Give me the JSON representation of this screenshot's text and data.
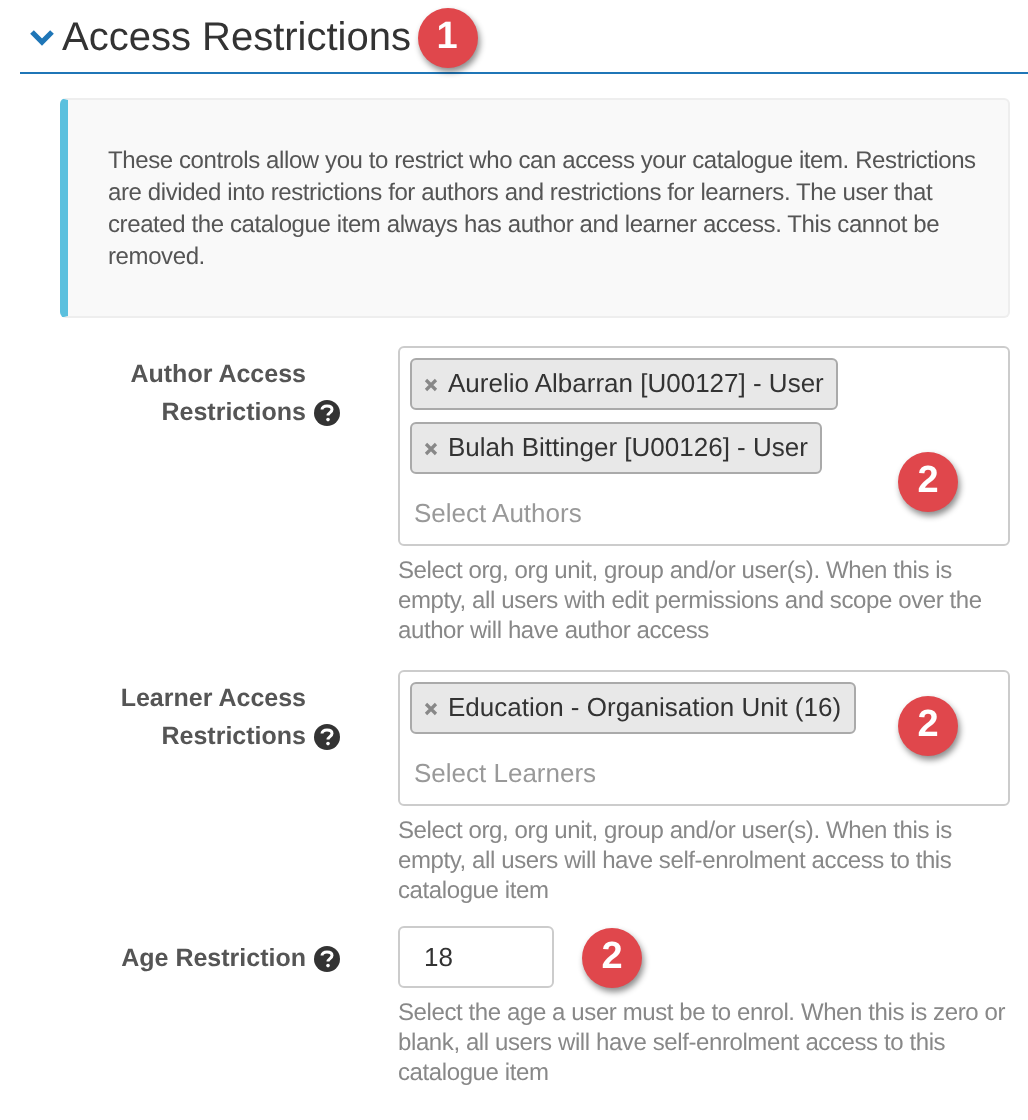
{
  "section": {
    "title": "Access Restrictions",
    "expanded": true,
    "badge": "1"
  },
  "info": "These controls allow you to restrict who can access your catalogue item. Restrictions are divided into restrictions for authors and restrictions for learners. The user that created the catalogue item always has author and learner access. This cannot be removed.",
  "fields": [
    {
      "kind": "multiselect",
      "label": "Author Access Restrictions",
      "tags": [
        "Aurelio Albarran [U00127] - User",
        "Bulah Bittinger [U00126] - User"
      ],
      "placeholder": "Select Authors",
      "badge": "2",
      "hint": "Select org, org unit, group and/or user(s). When this is empty, all users with edit permissions and scope over the author will have author access"
    },
    {
      "kind": "multiselect",
      "label": "Learner Access Restrictions",
      "tags": [
        "Education - Organisation Unit (16)"
      ],
      "placeholder": "Select Learners",
      "badge": "2",
      "hint": "Select org, org unit, group and/or user(s). When this is empty, all users will have self-enrolment access to this catalogue item"
    },
    {
      "kind": "number",
      "label": "Age Restriction",
      "value": "18",
      "badge": "2",
      "hint": "Select the age a user must be to enrol. When this is zero or blank, all users will have self-enrolment access to this catalogue item"
    }
  ]
}
